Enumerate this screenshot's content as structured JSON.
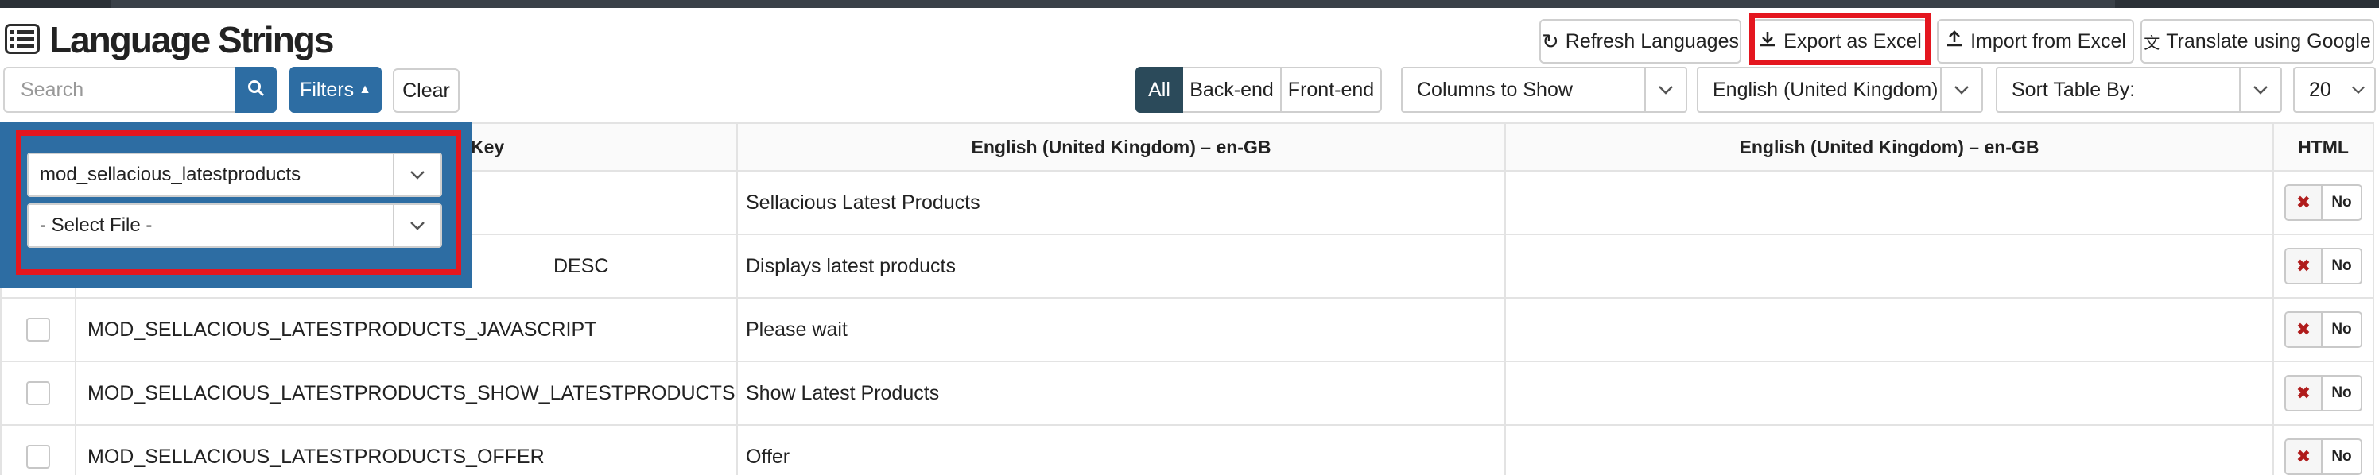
{
  "page_title": "Language Strings",
  "toolbar": {
    "refresh_label": "Refresh Languages",
    "export_label": "Export as Excel",
    "import_label": "Import from Excel",
    "translate_label": "Translate using Google"
  },
  "filter_bar": {
    "search_placeholder": "Search",
    "filters_label": "Filters",
    "clear_label": "Clear",
    "scope_all": "All",
    "scope_backend": "Back-end",
    "scope_frontend": "Front-end",
    "columns_label": "Columns to Show",
    "language_selected": "English (United Kingdom)",
    "sort_label": "Sort Table By:",
    "page_size": "20"
  },
  "filter_panel": {
    "module_selected": "mod_sellacious_latestproducts",
    "file_selected": "- Select File -"
  },
  "table": {
    "headers": {
      "key": "Key",
      "lang1": "English (United Kingdom) – en-GB",
      "lang2": "English (United Kingdom) – en-GB",
      "html": "HTML"
    },
    "rows": [
      {
        "key": "",
        "value": "Sellacious Latest Products",
        "html": "No"
      },
      {
        "key": "DESC",
        "value": "Displays latest products",
        "html": "No"
      },
      {
        "key": "MOD_SELLACIOUS_LATESTPRODUCTS_JAVASCRIPT",
        "value": "Please wait",
        "html": "No"
      },
      {
        "key": "MOD_SELLACIOUS_LATESTPRODUCTS_SHOW_LATESTPRODUCTS",
        "value": "Show Latest Products",
        "html": "No"
      },
      {
        "key": "MOD_SELLACIOUS_LATESTPRODUCTS_OFFER",
        "value": "Offer",
        "html": "No"
      }
    ]
  },
  "colors": {
    "primary": "#2d6da3",
    "highlight": "#e4161f",
    "dark_active": "#2b4a5a",
    "no_mark": "#b01c1c"
  }
}
